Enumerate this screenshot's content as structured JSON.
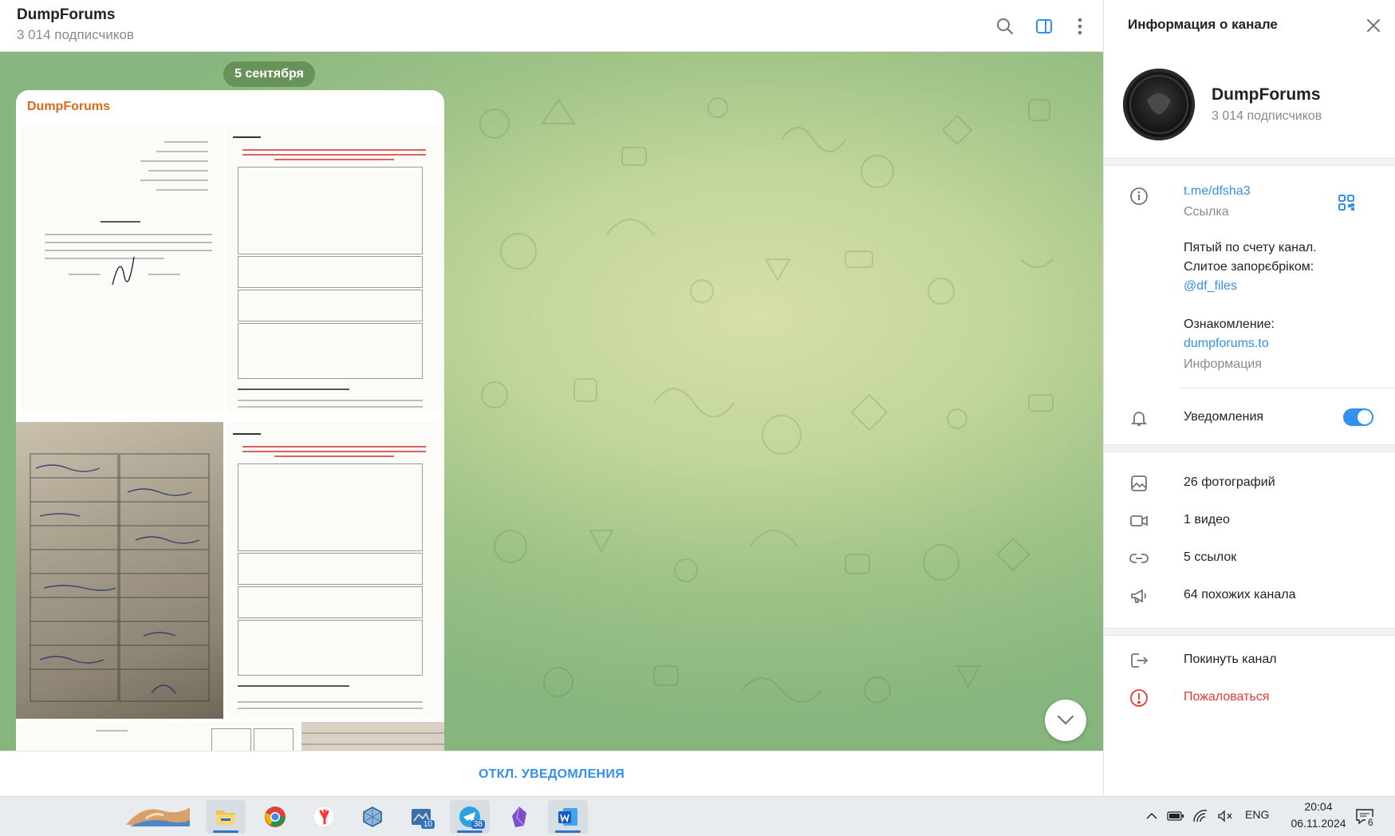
{
  "chat": {
    "title": "DumpForums",
    "subtitle": "3 014 подписчиков",
    "date_pill": "5 сентября",
    "post_author": "DumpForums",
    "mute_button": "ОТКЛ. УВЕДОМЛЕНИЯ"
  },
  "header_icons": [
    "search-icon",
    "sidebar-toggle-icon",
    "more-vertical-icon"
  ],
  "info_panel": {
    "title": "Информация о канале",
    "name": "DumpForums",
    "subscribers": "3 014 подписчиков",
    "link": "t.me/dfsha3",
    "link_caption": "Ссылка",
    "description_line1": "Пятый по счету канал.",
    "description_line2": "Слитое запорєбріком:",
    "description_mention": "@df_files",
    "description_line3": "Ознакомление:",
    "description_site": "dumpforums.to",
    "description_caption": "Информация",
    "notifications_label": "Уведомления",
    "notifications_enabled": true,
    "media": [
      {
        "icon": "photo-icon",
        "label": "26 фотографий"
      },
      {
        "icon": "video-icon",
        "label": "1 видео"
      },
      {
        "icon": "link-icon",
        "label": "5 ссылок"
      },
      {
        "icon": "megaphone-icon",
        "label": "64 похожих канала"
      }
    ],
    "actions": [
      {
        "icon": "leave-icon",
        "label": "Покинуть канал",
        "color": "#222222"
      },
      {
        "icon": "report-icon",
        "label": "Пожаловаться",
        "color": "#e53935"
      }
    ]
  },
  "taskbar": {
    "apps": [
      {
        "name": "file-explorer",
        "badge": ""
      },
      {
        "name": "chrome",
        "badge": ""
      },
      {
        "name": "yandex-browser",
        "badge": ""
      },
      {
        "name": "virtualbox",
        "badge": ""
      },
      {
        "name": "app-64-10",
        "badge": "10"
      },
      {
        "name": "telegram",
        "badge": "38"
      },
      {
        "name": "obsidian",
        "badge": ""
      },
      {
        "name": "word",
        "badge": ""
      }
    ],
    "language": "ENG",
    "time": "20:04",
    "date": "06.11.2024",
    "notification_count": "6"
  },
  "colors": {
    "accent": "#3390ec",
    "author": "#d96b1b",
    "danger": "#e53935"
  }
}
